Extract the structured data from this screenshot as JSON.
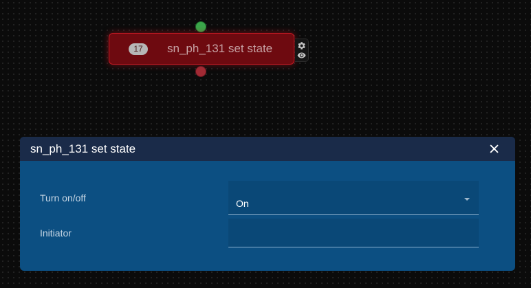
{
  "node": {
    "id_badge": "17",
    "title": "sn_ph_131 set state",
    "status_color": "#6e0a10",
    "input_port_color": "#3aa64a",
    "output_port_color": "#a12a34",
    "tools": [
      "gear-icon",
      "eye-icon"
    ]
  },
  "dialog": {
    "title": "sn_ph_131 set state",
    "close_icon": "close-icon",
    "fields": {
      "turn_on_off": {
        "label": "Turn on/off",
        "value": "On"
      },
      "initiator": {
        "label": "Initiator",
        "value": ""
      }
    }
  }
}
